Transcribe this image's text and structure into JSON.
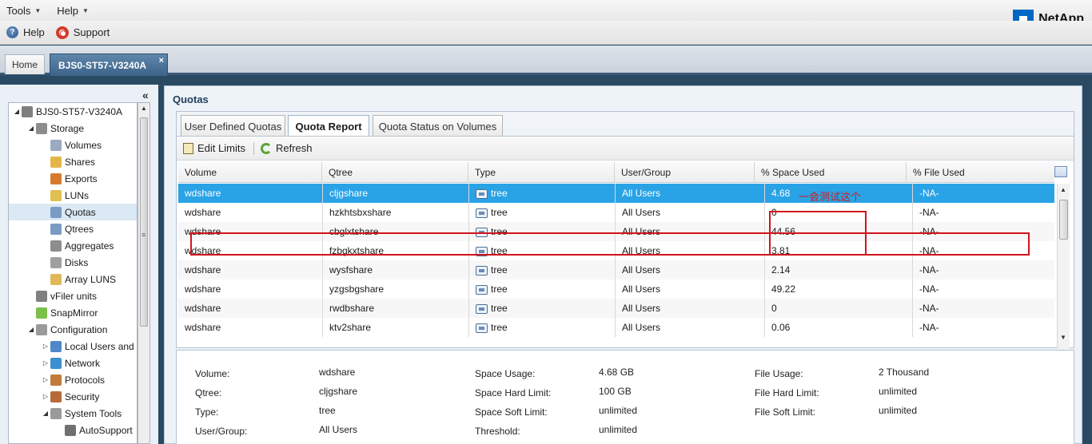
{
  "menubar": {
    "tools": "Tools",
    "help": "Help"
  },
  "toolbar": {
    "help": "Help",
    "support": "Support"
  },
  "logo": "NetApp",
  "tabs": {
    "home": "Home",
    "active": "BJS0-ST57-V3240A",
    "close": "×"
  },
  "tree": {
    "items": [
      {
        "label": "BJS0-ST57-V3240A",
        "expander": "◢",
        "icon": "storage-system-icon",
        "color": "#7e7e7e"
      },
      {
        "label": "Storage",
        "expander": "◢",
        "icon": "storage-icon",
        "color": "#8c8c8c"
      },
      {
        "label": "Volumes",
        "expander": "",
        "icon": "volume-icon",
        "color": "#9aaac4"
      },
      {
        "label": "Shares",
        "expander": "",
        "icon": "share-folder-icon",
        "color": "#e3b54a"
      },
      {
        "label": "Exports",
        "expander": "",
        "icon": "nfs-export-icon",
        "color": "#d77a2c"
      },
      {
        "label": "LUNs",
        "expander": "",
        "icon": "lun-icon",
        "color": "#e0c050"
      },
      {
        "label": "Quotas",
        "expander": "",
        "icon": "quota-icon",
        "color": "#7a9cc4"
      },
      {
        "label": "Qtrees",
        "expander": "",
        "icon": "qtree-icon",
        "color": "#7a9cc4"
      },
      {
        "label": "Aggregates",
        "expander": "",
        "icon": "aggregate-icon",
        "color": "#8d8d8d"
      },
      {
        "label": "Disks",
        "expander": "",
        "icon": "disk-icon",
        "color": "#a0a0a0"
      },
      {
        "label": "Array LUNS",
        "expander": "",
        "icon": "array-lun-icon",
        "color": "#e0b85a"
      },
      {
        "label": "vFiler units",
        "expander": "",
        "icon": "vfiler-icon",
        "color": "#808080"
      },
      {
        "label": "SnapMirror",
        "expander": "",
        "icon": "snapmirror-shield-icon",
        "color": "#7cc04a"
      },
      {
        "label": "Configuration",
        "expander": "◢",
        "icon": "configuration-wrench-icon",
        "color": "#9a9a9a"
      },
      {
        "label": "Local Users and",
        "expander": "▷",
        "icon": "users-icon",
        "color": "#4f87c9"
      },
      {
        "label": "Network",
        "expander": "▷",
        "icon": "network-globe-icon",
        "color": "#3d8fd1"
      },
      {
        "label": "Protocols",
        "expander": "▷",
        "icon": "protocols-icon",
        "color": "#c07a3a"
      },
      {
        "label": "Security",
        "expander": "▷",
        "icon": "security-icon",
        "color": "#b86a3a"
      },
      {
        "label": "System Tools",
        "expander": "◢",
        "icon": "system-tools-icon",
        "color": "#9a9a9a"
      },
      {
        "label": "AutoSupport",
        "expander": "",
        "icon": "autosupport-icon",
        "color": "#707070"
      }
    ]
  },
  "main": {
    "title": "Quotas",
    "subtabs": [
      "User Defined Quotas",
      "Quota Report",
      "Quota Status on Volumes"
    ],
    "tools": {
      "edit": "Edit Limits",
      "refresh": "Refresh"
    },
    "annotation": "一会测试这个",
    "columns": [
      "Volume",
      "Qtree",
      "Type",
      "User/Group",
      "% Space Used",
      "% File Used"
    ],
    "rows": [
      {
        "volume": "wdshare",
        "qtree": "cljgshare",
        "type": "tree",
        "user": "All Users",
        "space": "4.68",
        "file": "-NA-"
      },
      {
        "volume": "wdshare",
        "qtree": "hzkhtsbxshare",
        "type": "tree",
        "user": "All Users",
        "space": "0",
        "file": "-NA-"
      },
      {
        "volume": "wdshare",
        "qtree": "cbglxtshare",
        "type": "tree",
        "user": "All Users",
        "space": "44.56",
        "file": "-NA-"
      },
      {
        "volume": "wdshare",
        "qtree": "fzbgkxtshare",
        "type": "tree",
        "user": "All Users",
        "space": "3.81",
        "file": "-NA-"
      },
      {
        "volume": "wdshare",
        "qtree": "wysfshare",
        "type": "tree",
        "user": "All Users",
        "space": "2.14",
        "file": "-NA-"
      },
      {
        "volume": "wdshare",
        "qtree": "yzgsbgshare",
        "type": "tree",
        "user": "All Users",
        "space": "49.22",
        "file": "-NA-"
      },
      {
        "volume": "wdshare",
        "qtree": "rwdbshare",
        "type": "tree",
        "user": "All Users",
        "space": "0",
        "file": "-NA-"
      },
      {
        "volume": "wdshare",
        "qtree": "ktv2share",
        "type": "tree",
        "user": "All Users",
        "space": "0.06",
        "file": "-NA-"
      }
    ],
    "details": {
      "col1": [
        {
          "label": "Volume:",
          "value": "wdshare"
        },
        {
          "label": "Qtree:",
          "value": "cljgshare"
        },
        {
          "label": "Type:",
          "value": "tree"
        },
        {
          "label": "User/Group:",
          "value": "All Users"
        }
      ],
      "col2": [
        {
          "label": "Space Usage:",
          "value": "4.68 GB"
        },
        {
          "label": "Space Hard Limit:",
          "value": "100 GB"
        },
        {
          "label": "Space Soft Limit:",
          "value": "unlimited"
        },
        {
          "label": "Threshold:",
          "value": "unlimited"
        }
      ],
      "col3": [
        {
          "label": "File Usage:",
          "value": "2 Thousand"
        },
        {
          "label": "File Hard Limit:",
          "value": "unlimited"
        },
        {
          "label": "File Soft Limit:",
          "value": "unlimited"
        }
      ]
    }
  }
}
